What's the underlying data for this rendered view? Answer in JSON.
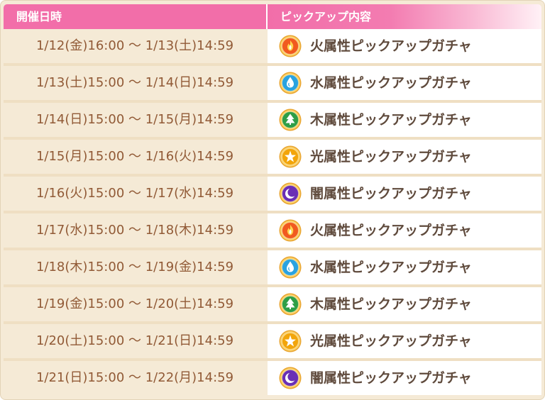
{
  "header": {
    "col_date": "開催日時",
    "col_content": "ピックアップ内容"
  },
  "colors": {
    "header_pink": "#f26ea9",
    "date_text": "#915a36",
    "content_text": "#5f4a3c",
    "fire": "#f15a1f",
    "water": "#2aa3e0",
    "wood": "#2e9e46",
    "light": "#f2a50a",
    "dark": "#6a2fb5"
  },
  "rows": [
    {
      "date": "1/12(金)16:00 ～ 1/13(土)14:59",
      "label": "火属性ピックアップガチャ",
      "icon": "fire-icon"
    },
    {
      "date": "1/13(土)15:00 ～ 1/14(日)14:59",
      "label": "水属性ピックアップガチャ",
      "icon": "water-drop-icon"
    },
    {
      "date": "1/14(日)15:00 ～ 1/15(月)14:59",
      "label": "木属性ピックアップガチャ",
      "icon": "tree-icon"
    },
    {
      "date": "1/15(月)15:00 ～ 1/16(火)14:59",
      "label": "光属性ピックアップガチャ",
      "icon": "star-icon"
    },
    {
      "date": "1/16(火)15:00 ～ 1/17(水)14:59",
      "label": "闇属性ピックアップガチャ",
      "icon": "moon-icon"
    },
    {
      "date": "1/17(水)15:00 ～ 1/18(木)14:59",
      "label": "火属性ピックアップガチャ",
      "icon": "fire-icon"
    },
    {
      "date": "1/18(木)15:00 ～ 1/19(金)14:59",
      "label": "水属性ピックアップガチャ",
      "icon": "water-drop-icon"
    },
    {
      "date": "1/19(金)15:00 ～ 1/20(土)14:59",
      "label": "木属性ピックアップガチャ",
      "icon": "tree-icon"
    },
    {
      "date": "1/20(土)15:00 ～ 1/21(日)14:59",
      "label": "光属性ピックアップガチャ",
      "icon": "star-icon"
    },
    {
      "date": "1/21(日)15:00 ～ 1/22(月)14:59",
      "label": "闇属性ピックアップガチャ",
      "icon": "moon-icon"
    }
  ]
}
